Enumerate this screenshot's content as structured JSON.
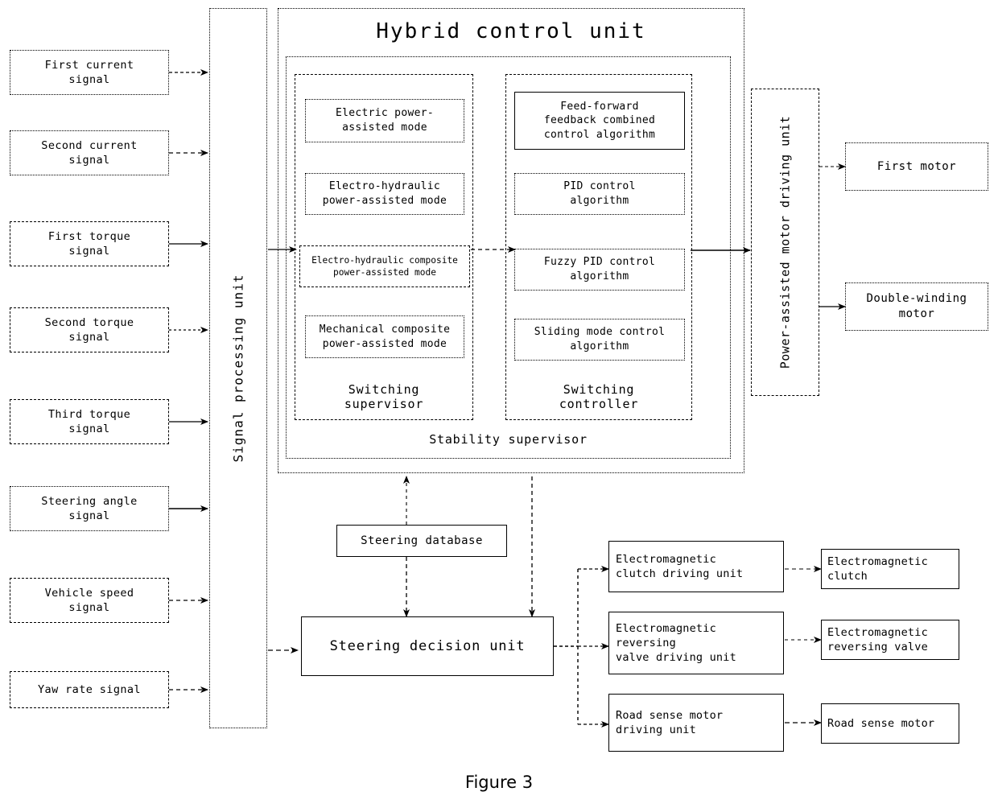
{
  "figure": {
    "caption": "Figure 3"
  },
  "input_signals": [
    {
      "label": "First current\nsignal"
    },
    {
      "label": "Second current\nsignal"
    },
    {
      "label": "First torque\nsignal"
    },
    {
      "label": "Second torque\nsignal"
    },
    {
      "label": "Third torque\nsignal"
    },
    {
      "label": "Steering angle\nsignal"
    },
    {
      "label": "Vehicle speed\nsignal"
    },
    {
      "label": "Yaw rate signal"
    }
  ],
  "signal_processing": {
    "label": "Signal processing unit"
  },
  "hybrid_control_unit": {
    "title": "Hybrid control unit",
    "stability_supervisor_label": "Stability supervisor",
    "switching_supervisor": {
      "label": "Switching\nsupervisor",
      "modes": [
        {
          "label": "Electric power-\nassisted mode"
        },
        {
          "label": "Electro-hydraulic\npower-assisted mode"
        },
        {
          "label": "Electro-hydraulic  composite\npower-assisted mode"
        },
        {
          "label": "Mechanical composite\npower-assisted mode"
        }
      ]
    },
    "switching_controller": {
      "label": "Switching\ncontroller",
      "algorithms": [
        {
          "label": "Feed-forward\nfeedback combined\ncontrol algorithm"
        },
        {
          "label": "PID control\nalgorithm"
        },
        {
          "label": "Fuzzy PID control\nalgorithm"
        },
        {
          "label": "Sliding mode control\nalgorithm"
        }
      ]
    }
  },
  "power_assisted_motor_driving_unit": {
    "label": "Power-assisted motor\ndriving unit"
  },
  "motors": [
    {
      "label": "First motor"
    },
    {
      "label": "Double-winding\nmotor"
    }
  ],
  "steering_database": {
    "label": "Steering database"
  },
  "steering_decision_unit": {
    "label": "Steering decision unit"
  },
  "driving_units": [
    {
      "label": "Electromagnetic\nclutch driving unit"
    },
    {
      "label": "Electromagnetic\nreversing\nvalve driving unit"
    },
    {
      "label": "Road sense motor\ndriving unit"
    }
  ],
  "actuators": [
    {
      "label": "Electromagnetic\nclutch"
    },
    {
      "label": "Electromagnetic\nreversing valve"
    },
    {
      "label": "Road sense motor"
    }
  ],
  "colors": {
    "line": "#000000",
    "background": "#ffffff"
  }
}
